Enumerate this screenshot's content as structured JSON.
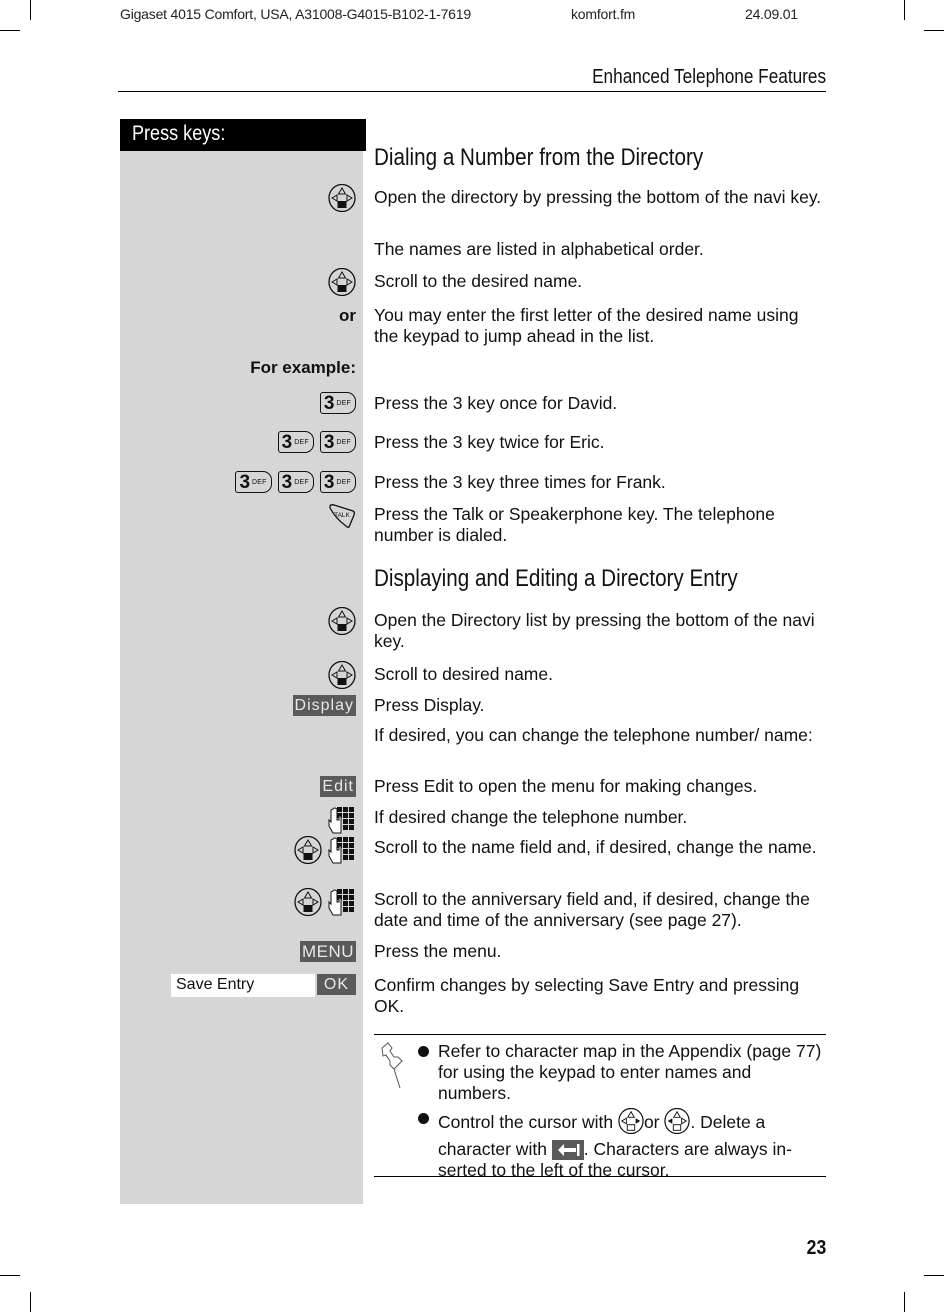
{
  "header": {
    "doc_id": "Gigaset 4015 Comfort, USA, A31008-G4015-B102-1-7619",
    "file": "komfort.fm",
    "date": "24.09.01"
  },
  "chapter_title": "Enhanced Telephone Features",
  "press_keys_label": "Press keys:",
  "section1": {
    "title": "Dialing a Number from the Directory",
    "rows": [
      {
        "key": "navi-key-down",
        "text": "Open the directory by pressing the bottom of the navi key."
      },
      {
        "key": "",
        "text": "The names are listed in alphabetical order."
      },
      {
        "key": "navi-key-down",
        "text": "Scroll to the desired name."
      },
      {
        "key_label": "or",
        "text": "You may enter the first letter of the desired name using the keypad to jump ahead in the list."
      },
      {
        "key_label": "For example:",
        "text": ""
      },
      {
        "key": "3-DEF x1",
        "text": "Press the 3 key once for David."
      },
      {
        "key": "3-DEF x2",
        "text": "Press the 3 key twice for Eric."
      },
      {
        "key": "3-DEF x3",
        "text": "Press the 3 key three times for Frank."
      },
      {
        "key": "talk-key",
        "text": "Press the Talk or Speakerphone key. The telephone number is dialed."
      }
    ],
    "key3": {
      "digit": "3",
      "letters": "DEF"
    },
    "talk_label": "TALK"
  },
  "section2": {
    "title": "Displaying and Editing a Directory Entry",
    "rows": [
      {
        "key": "navi-key-down",
        "text": "Open the Directory list by pressing the bottom of the navi key."
      },
      {
        "key": "navi-key-down",
        "text": "Scroll to desired name."
      },
      {
        "key_label": "Display",
        "text": "Press Display."
      },
      {
        "key": "",
        "text": "If desired, you can change the telephone number/ name:"
      },
      {
        "key_label": "Edit",
        "text": "Press Edit to open the menu for making changes."
      },
      {
        "key": "keypad",
        "text": "If desired change the telephone number."
      },
      {
        "key": "navi-key + keypad",
        "text": "Scroll to the name field and, if desired, change the name."
      },
      {
        "key": "navi-key + keypad",
        "text": "Scroll to the anniversary field and, if desired, change the date and time of the anniversary (see page 27)."
      },
      {
        "key_label": "MENU",
        "text": "Press the menu."
      },
      {
        "key_label": "OK",
        "menu_item": "Save Entry",
        "text": "Confirm changes by selecting Save Entry and pressing OK."
      }
    ]
  },
  "note": {
    "items": [
      {
        "text": "Refer to character map in the Appendix (page 77) for using the keypad to enter names and numbers."
      },
      {
        "text_parts": [
          "Control the cursor with ",
          "or ",
          ". Delete a character with ",
          ". Characters are always in-serted to the left of the cursor."
        ]
      }
    ]
  },
  "page_number": "23"
}
